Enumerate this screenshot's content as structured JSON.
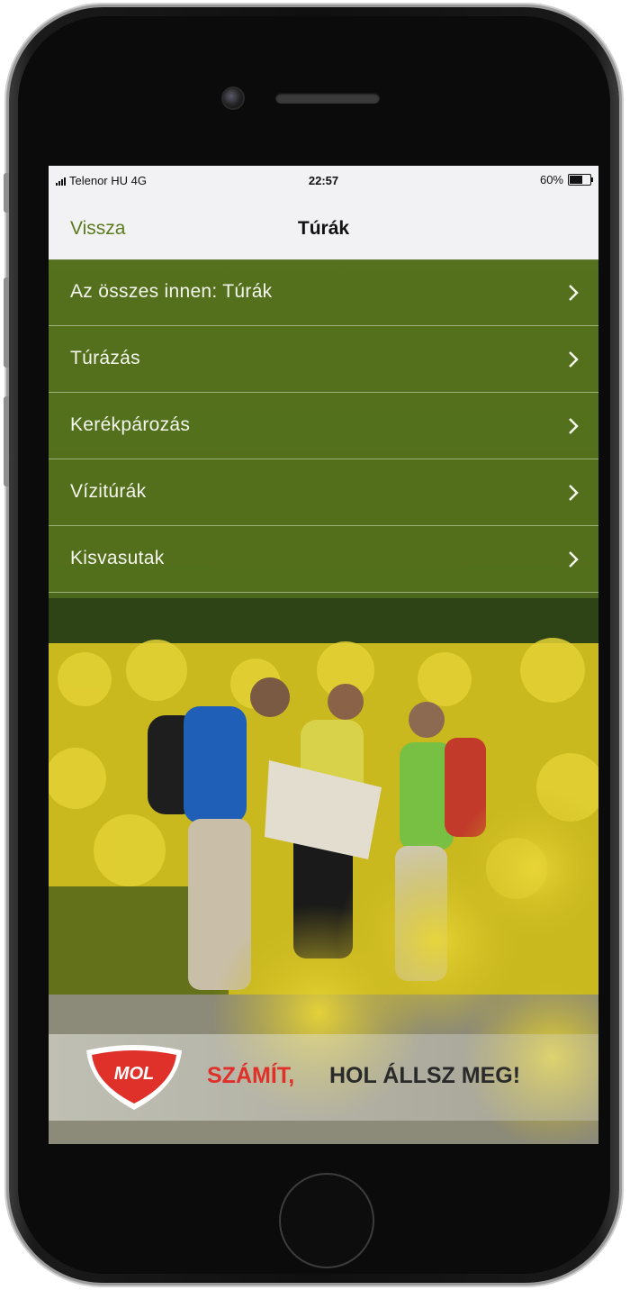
{
  "status_bar": {
    "carrier": "Telenor HU 4G",
    "time": "22:57",
    "battery": "60%"
  },
  "nav": {
    "back_label": "Vissza",
    "title": "Túrák"
  },
  "menu": {
    "items": [
      {
        "label": "Az összes innen: Túrák"
      },
      {
        "label": "Túrázás"
      },
      {
        "label": "Kerékpározás"
      },
      {
        "label": "Vízitúrák"
      },
      {
        "label": "Kisvasutak"
      }
    ]
  },
  "ad": {
    "logo_text": "MOL",
    "slogan_highlight": "SZÁMÍT,",
    "slogan_rest": "HOL ÁLLSZ MEG!"
  },
  "colors": {
    "accent_green": "#54701c",
    "mol_red": "#e0302a"
  }
}
